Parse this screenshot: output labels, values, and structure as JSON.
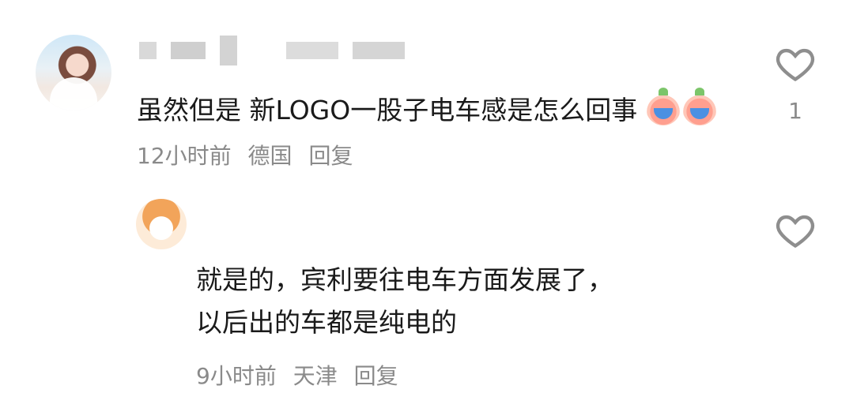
{
  "comment": {
    "text": "虽然但是 新LOGO一股子电车感是怎么回事",
    "time": "12小时前",
    "location": "德国",
    "reply_label": "回复",
    "like_count": "1",
    "emojis": [
      "crying-peach-emoji",
      "crying-peach-emoji"
    ]
  },
  "reply": {
    "text_line1": "就是的，宾利要往电车方面发展了，",
    "text_line2": "以后出的车都是纯电的",
    "time": "9小时前",
    "location": "天津",
    "reply_label": "回复"
  },
  "icons": {
    "like": "heart-outline-icon"
  },
  "colors": {
    "text": "#1a1a1a",
    "meta": "#8a8a8a",
    "icon": "#8e8e8e"
  }
}
